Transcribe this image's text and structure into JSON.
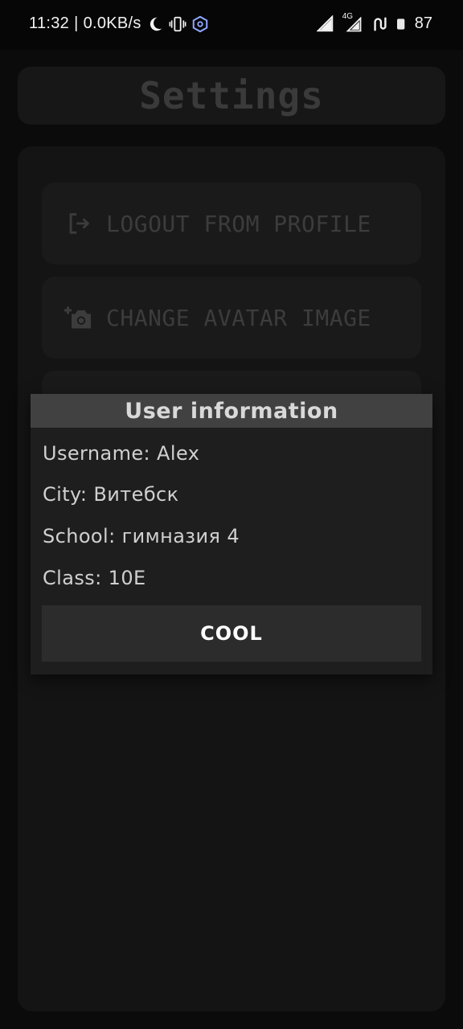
{
  "status_bar": {
    "time": "11:32",
    "separator": "|",
    "net_speed": "0.0KB/s",
    "network_type": "4G",
    "battery": "87",
    "icons": [
      "moon-icon",
      "vibrate-icon",
      "vpn-icon",
      "signal-icon",
      "signal-4g-icon",
      "data-icon",
      "battery-icon"
    ]
  },
  "header": {
    "title": "Settings"
  },
  "menu": {
    "logout_label": "LOGOUT FROM PROFILE",
    "change_avatar_label": "CHANGE AVATAR IMAGE"
  },
  "dialog": {
    "title": "User information",
    "username": "Username: Alex",
    "city": "City: Витебск",
    "school": "School: гимназия 4",
    "class": "Class: 10E",
    "confirm_label": "COOL"
  },
  "colors": {
    "background": "#060606",
    "dialog_bg": "#1e1e1e",
    "dialog_title_bg": "#414141",
    "button_bg": "#2c2c2c"
  }
}
